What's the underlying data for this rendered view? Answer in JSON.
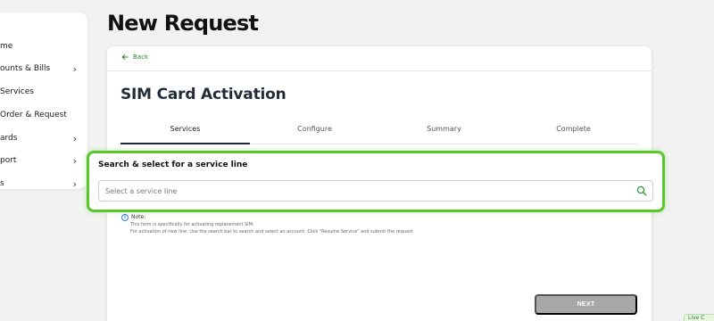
{
  "sidebar": {
    "items": [
      {
        "label": "me",
        "has_chevron": false
      },
      {
        "label": "ounts & Bills",
        "has_chevron": true
      },
      {
        "label": "Services",
        "has_chevron": false
      },
      {
        "label": "Order & Request",
        "has_chevron": false
      },
      {
        "label": "ards",
        "has_chevron": true
      },
      {
        "label": "port",
        "has_chevron": true
      },
      {
        "label": "s",
        "has_chevron": true
      }
    ],
    "chevron_icon": "chevron-right-icon"
  },
  "page": {
    "title": "New Request"
  },
  "card": {
    "back_label": "Back",
    "title": "SIM Card Activation",
    "steps": [
      {
        "label": "Services",
        "active": true
      },
      {
        "label": "Configure",
        "active": false
      },
      {
        "label": "Summary",
        "active": false
      },
      {
        "label": "Complete",
        "active": false
      }
    ]
  },
  "search": {
    "label": "Search & select for a service line",
    "placeholder": "Select a service line",
    "value": "",
    "icon": "search-icon",
    "highlight_color": "#59c72b"
  },
  "note": {
    "title": "Note:",
    "lines": [
      "This form is specifically for activating replacement SIM.",
      "For activation of new line: Use the search bar to search and select an account. Click \"Resume Service\" and submit the request"
    ]
  },
  "actions": {
    "next_label": "NEXT"
  },
  "corner": {
    "label": "Live C"
  },
  "colors": {
    "accent_green": "#59c72b",
    "back_link_green": "#2e7d32",
    "title_navy": "#222d3a",
    "disabled_button": "#a8a8a8",
    "info_blue": "#2a7bd6"
  }
}
